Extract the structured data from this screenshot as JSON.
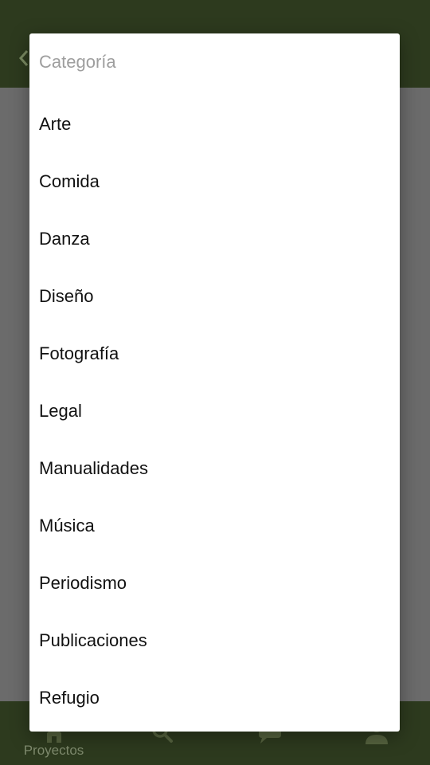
{
  "colors": {
    "primary_dark": "#2d3a1e",
    "scrim": "#6b6b6b",
    "dialog_bg": "#ffffff",
    "title_text": "#9e9e9e",
    "option_text": "#111111",
    "nav_inactive": "#7e8a6d"
  },
  "dialog": {
    "title": "Categoría",
    "options": [
      "Arte",
      "Comida",
      "Danza",
      "Diseño",
      "Fotografía",
      "Legal",
      "Manualidades",
      "Música",
      "Periodismo",
      "Publicaciones",
      "Refugio"
    ]
  },
  "bottom_nav": {
    "items": [
      {
        "label": "Proyectos",
        "icon": "home-icon"
      },
      {
        "label": "",
        "icon": "search-icon"
      },
      {
        "label": "",
        "icon": "chat-icon"
      },
      {
        "label": "",
        "icon": "profile-icon"
      }
    ]
  }
}
